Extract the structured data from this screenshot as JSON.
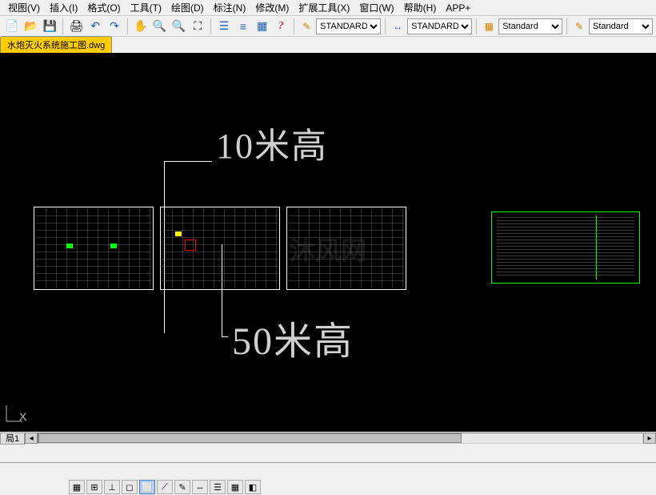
{
  "menu": {
    "items": [
      {
        "label": "视图(V)",
        "key": "V"
      },
      {
        "label": "插入(I)",
        "key": "I"
      },
      {
        "label": "格式(O)",
        "key": "O"
      },
      {
        "label": "工具(T)",
        "key": "T"
      },
      {
        "label": "绘图(D)",
        "key": "D"
      },
      {
        "label": "标注(N)",
        "key": "N"
      },
      {
        "label": "修改(M)",
        "key": "M"
      },
      {
        "label": "扩展工具(X)",
        "key": "X"
      },
      {
        "label": "窗口(W)",
        "key": "W"
      },
      {
        "label": "帮助(H)",
        "key": "H"
      },
      {
        "label": "APP+",
        "key": ""
      }
    ]
  },
  "toolbar": {
    "icons": {
      "new": "📄",
      "open": "📂",
      "save": "💾",
      "print": "🖨",
      "undo": "↶",
      "redo": "↷",
      "pan": "✋",
      "zoom_in": "🔍",
      "zoom_out": "🔍",
      "zoom_ext": "⛶",
      "props": "☰",
      "list": "≡",
      "table": "▦",
      "help": "?"
    },
    "style_dropdowns": [
      {
        "icon": "✎",
        "value": "STANDARD"
      },
      {
        "icon": "↔",
        "value": "STANDARD"
      },
      {
        "icon": "▦",
        "value": "Standard"
      },
      {
        "icon": "✎",
        "value": "Standard"
      }
    ]
  },
  "file_tab": {
    "name": "水炮灭火系统施工图.dwg"
  },
  "drawing": {
    "text_top": "10米高",
    "text_bottom": "50米高",
    "ucs_label": "X",
    "watermark": "沐风网"
  },
  "layout": {
    "tab_label": "局1",
    "arrows": {
      "left": "◂",
      "right": "▸"
    }
  },
  "status": {
    "toggles": [
      "▦",
      "⊞",
      "⊥",
      "◻",
      "⬜",
      "⟋",
      "✎",
      "↔",
      "☰",
      "▦",
      "◧"
    ]
  }
}
